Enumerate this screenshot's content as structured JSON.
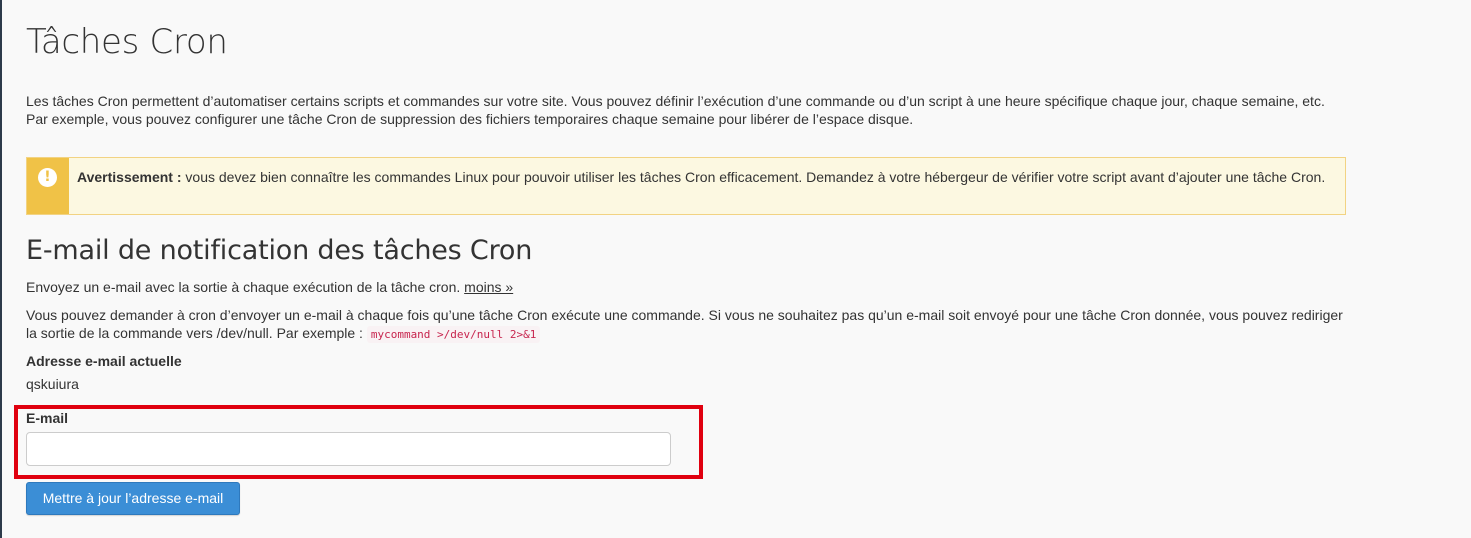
{
  "page": {
    "title": "Tâches Cron",
    "intro": "Les tâches Cron permettent d’automatiser certains scripts et commandes sur votre site. Vous pouvez définir l’exécution d’une commande ou d’un script à une heure spécifique chaque jour, chaque semaine, etc. Par exemple, vous pouvez configurer une tâche Cron de suppression des fichiers temporaires chaque semaine pour libérer de l’espace disque."
  },
  "warning": {
    "icon": "exclamation-icon",
    "label": "Avertissement :",
    "text": " vous devez bien connaître les commandes Linux pour pouvoir utiliser les tâches Cron efficacement. Demandez à votre hébergeur de vérifier votre script avant d’ajouter une tâche Cron.",
    "colors": {
      "accent": "#f0c247",
      "background": "#fcf8e1",
      "border": "#f2d383"
    }
  },
  "notification": {
    "title": "E-mail de notification des tâches Cron",
    "description": "Envoyez un e-mail avec la sortie à chaque exécution de la tâche cron.",
    "less_link": "moins »",
    "detail": "Vous pouvez demander à cron d’envoyer un e-mail à chaque fois qu’une tâche Cron exécute une commande. Si vous ne souhaitez pas qu’un e-mail soit envoyé pour une tâche Cron donnée, vous pouvez rediriger la sortie de la commande vers /dev/null. Par exemple :",
    "example_command": "mycommand >/dev/null 2>&1",
    "current_label": "Adresse e-mail actuelle",
    "current_value": "qskuiura",
    "email_label": "E-mail",
    "email_value": "",
    "email_placeholder": "",
    "update_button": "Mettre à jour l’adresse e-mail"
  },
  "colors": {
    "button": "#3b8ed6",
    "highlight": "#e0000f",
    "code": "#c7254e"
  }
}
